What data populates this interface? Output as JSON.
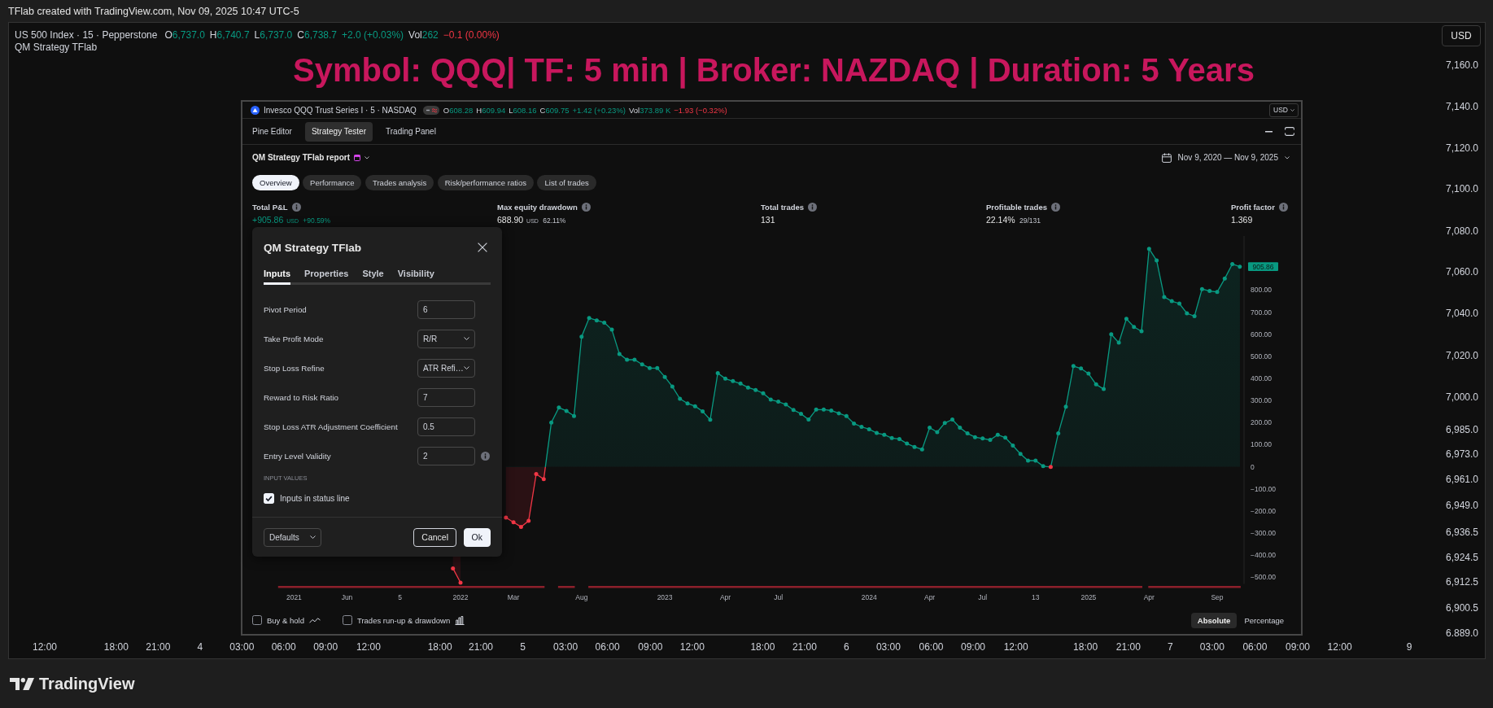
{
  "caption": "TFlab created with TradingView.com, Nov 09, 2025 10:47 UTC-5",
  "chart": {
    "legend": {
      "symbol": "US 500 Index · 15 · Pepperstone",
      "values": [
        {
          "label": "O",
          "value": "6,737.0",
          "negative": false
        },
        {
          "label": "H",
          "value": "6,740.7",
          "negative": false
        },
        {
          "label": "L",
          "value": "6,737.0",
          "negative": false
        },
        {
          "label": "C",
          "value": "6,738.7",
          "negative": false
        },
        {
          "value": "+2.0 (+0.03%)",
          "negative": false
        },
        {
          "label": "Vol",
          "value": "262",
          "negative": false
        },
        {
          "value": "−0.1 (0.00%)",
          "negative": true
        }
      ],
      "indicator": "QM Strategy TFlab"
    },
    "overlay_title": "Symbol: QQQ| TF: 5 min | Broker: NAZDAQ | Duration: 5 Years",
    "currency": "USD",
    "price_axis": [
      "7,160.0",
      "7,140.0",
      "7,120.0",
      "7,100.0",
      "7,080.0",
      "7,060.0",
      "7,040.0",
      "7,020.0",
      "7,000.0",
      "6,985.0",
      "6,973.0",
      "6,961.0",
      "6,949.0",
      "6,936.5",
      "6,924.5",
      "6,912.5",
      "6,900.5",
      "6.889.0"
    ],
    "time_axis": [
      "12:00",
      "18:00",
      "21:00",
      "4",
      "03:00",
      "06:00",
      "09:00",
      "12:00",
      "18:00",
      "21:00",
      "5",
      "03:00",
      "06:00",
      "09:00",
      "12:00",
      "18:00",
      "21:00",
      "6",
      "03:00",
      "06:00",
      "09:00",
      "12:00",
      "18:00",
      "21:00",
      "7",
      "03:00",
      "06:00",
      "09:00",
      "12:00",
      "9"
    ]
  },
  "strategy_window": {
    "legend": {
      "symbol": "Invesco QQQ Trust Series I · 5 · NASDAQ",
      "values": [
        {
          "label": "O",
          "value": "608.28",
          "negative": false
        },
        {
          "label": "H",
          "value": "609.94",
          "negative": false
        },
        {
          "label": "L",
          "value": "608.16",
          "negative": false
        },
        {
          "label": "C",
          "value": "609.75",
          "negative": false
        },
        {
          "value": "+1.42 (+0.23%)",
          "negative": false
        },
        {
          "label": "Vol",
          "value": "373.89 K",
          "negative": false
        },
        {
          "value": "−1.93 (−0.32%)",
          "negative": true
        }
      ],
      "currency": "USD"
    },
    "tabs": [
      {
        "label": "Pine Editor",
        "selected": false
      },
      {
        "label": "Strategy Tester",
        "selected": true
      },
      {
        "label": "Trading Panel",
        "selected": false
      }
    ],
    "report": {
      "title": "QM Strategy TFlab report",
      "date_range": "Nov 9, 2020 — Nov 9, 2025"
    },
    "report_tabs": [
      {
        "label": "Overview",
        "selected": true
      },
      {
        "label": "Performance",
        "selected": false
      },
      {
        "label": "Trades analysis",
        "selected": false
      },
      {
        "label": "Risk/performance ratios",
        "selected": false
      },
      {
        "label": "List of trades",
        "selected": false
      }
    ],
    "metrics": [
      {
        "label": "Total P&L",
        "value": "+905.86",
        "unit": "USD",
        "detail": "+90.59%",
        "positive": true
      },
      {
        "label": "Max equity drawdown",
        "value": "688.90",
        "unit": "USD",
        "detail": "62.11%",
        "positive": false
      },
      {
        "label": "Total trades",
        "value": "131",
        "positive": false
      },
      {
        "label": "Profitable trades",
        "value": "22.14%",
        "detail": "29/131",
        "positive": false
      },
      {
        "label": "Profit factor",
        "value": "1.369",
        "positive": false
      }
    ],
    "chart_data": {
      "type": "area",
      "categories": [
        null,
        null,
        "2021",
        null,
        null,
        null,
        null,
        null,
        null,
        "Jun",
        null,
        null,
        null,
        null,
        null,
        null,
        "5",
        null,
        null,
        null,
        null,
        null,
        null,
        null,
        "2022",
        null,
        null,
        null,
        null,
        null,
        null,
        "Mar",
        null,
        null,
        null,
        null,
        null,
        null,
        null,
        null,
        "Aug",
        null,
        null,
        null,
        null,
        null,
        null,
        null,
        null,
        null,
        null,
        "2023",
        null,
        null,
        null,
        null,
        null,
        null,
        null,
        "Apr",
        null,
        null,
        null,
        null,
        null,
        null,
        "Jul",
        null,
        null,
        null,
        null,
        null,
        null,
        null,
        null,
        null,
        null,
        null,
        "2024",
        null,
        null,
        null,
        null,
        null,
        null,
        null,
        "Apr",
        null,
        null,
        null,
        null,
        null,
        null,
        "Jul",
        null,
        null,
        null,
        null,
        null,
        null,
        "13",
        null,
        null,
        null,
        null,
        null,
        null,
        "2025",
        null,
        null,
        null,
        null,
        null,
        null,
        null,
        "Apr",
        null,
        null,
        null,
        null,
        null,
        null,
        null,
        null,
        "Sep",
        null,
        null,
        null
      ],
      "values": [
        null,
        null,
        null,
        null,
        null,
        null,
        null,
        null,
        null,
        null,
        null,
        null,
        null,
        null,
        null,
        null,
        null,
        null,
        null,
        null,
        null,
        null,
        null,
        -460,
        -525,
        null,
        null,
        null,
        null,
        null,
        -230,
        -251,
        -272,
        -245,
        -33,
        -56,
        200,
        268,
        253,
        230,
        589,
        674,
        663,
        653,
        621,
        511,
        485,
        485,
        464,
        447,
        447,
        407,
        363,
        308,
        287,
        274,
        251,
        213,
        424,
        399,
        388,
        377,
        359,
        348,
        333,
        304,
        295,
        282,
        257,
        240,
        214,
        259,
        259,
        255,
        242,
        230,
        196,
        181,
        170,
        153,
        145,
        130,
        126,
        105,
        90,
        79,
        177,
        157,
        198,
        214,
        177,
        151,
        134,
        128,
        122,
        145,
        132,
        96,
        58,
        28,
        28,
        3,
        -1,
        151,
        272,
        456,
        445,
        422,
        373,
        352,
        600,
        562,
        670,
        633,
        614,
        987,
        934,
        769,
        750,
        739,
        695,
        682,
        805,
        796,
        792,
        852,
        918,
        906
      ],
      "ylim": [
        -530,
        1045
      ],
      "yticks": [
        {
          "value": -500,
          "label": "−500.00"
        },
        {
          "value": -400,
          "label": "−400.00"
        },
        {
          "value": -300,
          "label": "−300.00"
        },
        {
          "value": -200,
          "label": "−200.00"
        },
        {
          "value": -100,
          "label": "−100.00"
        },
        {
          "value": 0,
          "label": "0"
        },
        {
          "value": 100,
          "label": "100.00"
        },
        {
          "value": 200,
          "label": "200.00"
        },
        {
          "value": 300,
          "label": "300.00"
        },
        {
          "value": 400,
          "label": "400.00"
        },
        {
          "value": 500,
          "label": "500.00"
        },
        {
          "value": 600,
          "label": "600.00"
        },
        {
          "value": 700,
          "label": "700.00"
        },
        {
          "value": 800,
          "label": "800.00"
        }
      ]
    },
    "last_value": "905.86",
    "options": [
      {
        "label": "Buy & hold",
        "checked": false,
        "kind": "line"
      },
      {
        "label": "Trades run-up & drawdown",
        "checked": false,
        "kind": "bars"
      }
    ],
    "scale_modes": [
      {
        "label": "Absolute",
        "selected": true
      },
      {
        "label": "Percentage",
        "selected": false
      }
    ]
  },
  "settings_dialog": {
    "title": "QM Strategy TFlab",
    "tabs": [
      {
        "label": "Inputs",
        "selected": true
      },
      {
        "label": "Properties",
        "selected": false
      },
      {
        "label": "Style",
        "selected": false
      },
      {
        "label": "Visibility",
        "selected": false
      }
    ],
    "inputs": [
      {
        "label": "Pivot Period",
        "value": "6",
        "kind": "number",
        "info": false
      },
      {
        "label": "Take Profit Mode",
        "value": "R/R",
        "kind": "select",
        "info": false
      },
      {
        "label": "Stop Loss Refine",
        "value": "ATR Refi…",
        "kind": "select",
        "info": false
      },
      {
        "label": "Reward to Risk Ratio",
        "value": "7",
        "kind": "number",
        "info": false
      },
      {
        "label": "Stop Loss ATR Adjustment Coefficient",
        "value": "0.5",
        "kind": "number",
        "info": false
      },
      {
        "label": "Entry Level Validity",
        "value": "2",
        "kind": "number",
        "info": true
      }
    ],
    "section_label": "INPUT VALUES",
    "checkbox": {
      "label": "Inputs in status line",
      "checked": true
    },
    "preset": "Defaults",
    "buttons": [
      {
        "label": "Cancel",
        "kind": "secondary"
      },
      {
        "label": "Ok",
        "kind": "primary"
      }
    ]
  },
  "footer": {
    "brand": "TradingView"
  }
}
